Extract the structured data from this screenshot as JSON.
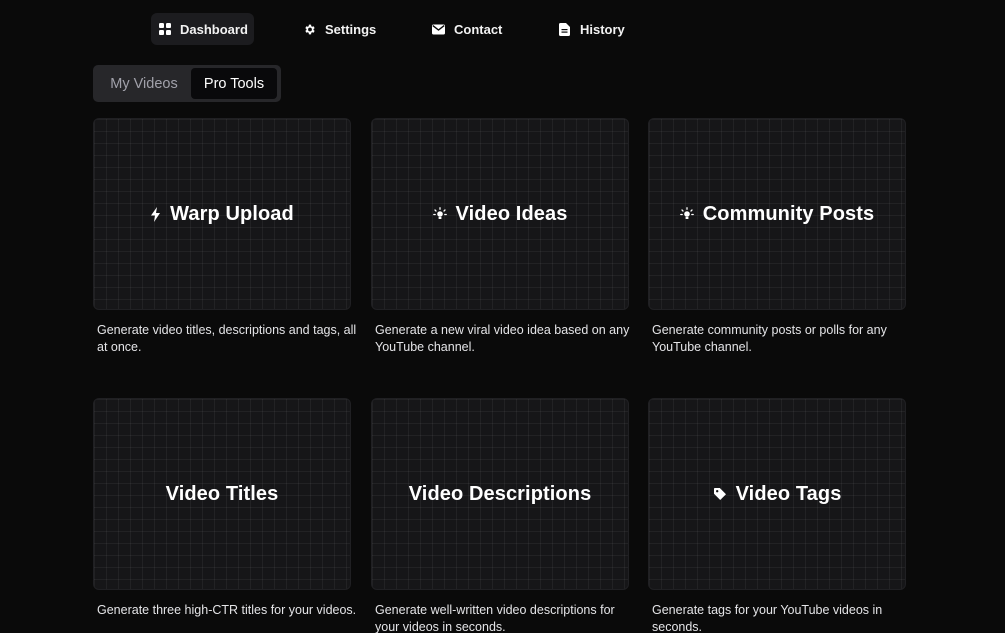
{
  "nav": {
    "items": [
      {
        "label": "Dashboard",
        "icon": "dashboard-grid-icon",
        "active": true
      },
      {
        "label": "Settings",
        "icon": "gear-icon",
        "active": false
      },
      {
        "label": "Contact",
        "icon": "envelope-icon",
        "active": false
      },
      {
        "label": "History",
        "icon": "document-icon",
        "active": false
      }
    ]
  },
  "tabs": {
    "items": [
      {
        "label": "My Videos",
        "active": false
      },
      {
        "label": "Pro Tools",
        "active": true
      }
    ]
  },
  "cards": [
    {
      "title": "Warp Upload",
      "icon": "lightning-icon",
      "description": "Generate video titles, descriptions and tags, all at once."
    },
    {
      "title": "Video Ideas",
      "icon": "lightbulb-icon",
      "description": "Generate a new viral video idea based on any YouTube channel."
    },
    {
      "title": "Community Posts",
      "icon": "lightbulb-icon",
      "description": "Generate community posts or polls for any YouTube channel."
    },
    {
      "title": "Video Titles",
      "icon": "",
      "description": "Generate three high-CTR titles for your videos."
    },
    {
      "title": "Video Descriptions",
      "icon": "",
      "description": "Generate well-written video descriptions for your videos in seconds."
    },
    {
      "title": "Video Tags",
      "icon": "tag-icon",
      "description": "Generate tags for your YouTube videos in seconds."
    }
  ],
  "colors": {
    "background": "#0a0a0a",
    "card_background": "#161618",
    "tab_container": "#27272a",
    "active_tab": "#09090b",
    "active_nav": "#1c1c1f"
  }
}
